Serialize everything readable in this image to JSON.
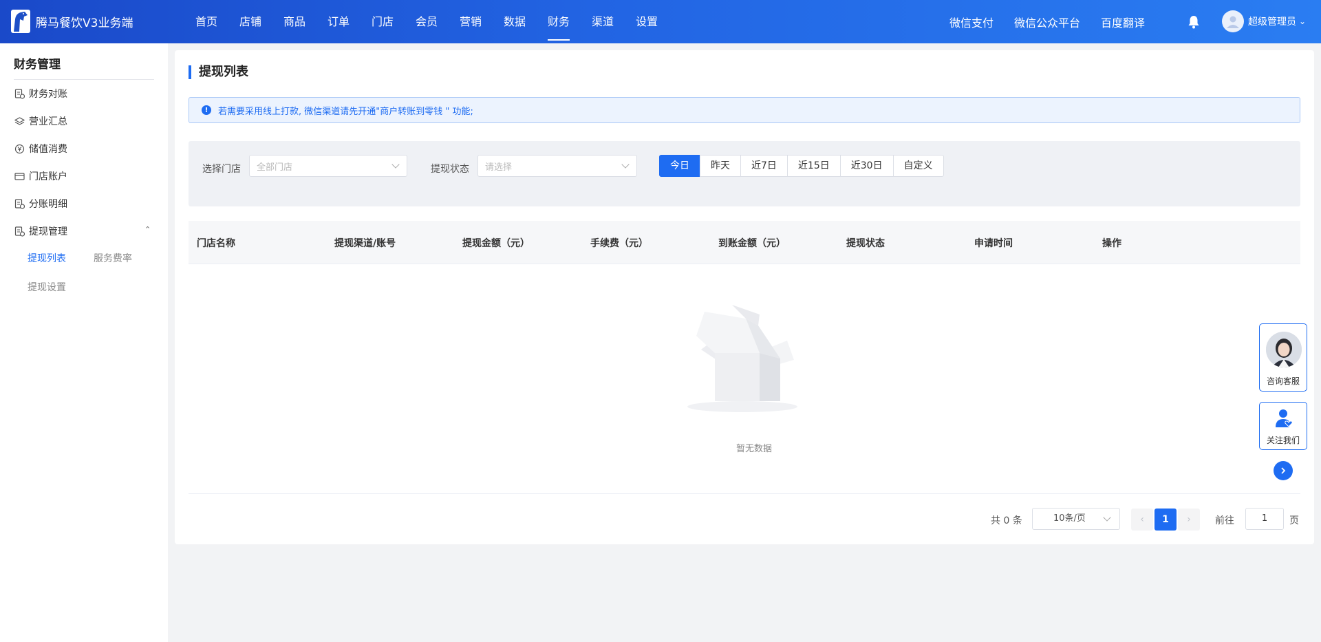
{
  "app": {
    "title": "腾马餐饮V3业务端"
  },
  "nav": {
    "items": [
      {
        "label": "首页"
      },
      {
        "label": "店铺"
      },
      {
        "label": "商品"
      },
      {
        "label": "订单"
      },
      {
        "label": "门店"
      },
      {
        "label": "会员"
      },
      {
        "label": "营销"
      },
      {
        "label": "数据"
      },
      {
        "label": "财务",
        "active": true
      },
      {
        "label": "渠道"
      },
      {
        "label": "设置"
      }
    ],
    "right_links": [
      "微信支付",
      "微信公众平台",
      "百度翻译"
    ],
    "user_name": "超级管理员"
  },
  "sidebar": {
    "title": "财务管理",
    "items": [
      {
        "label": "财务对账",
        "icon": "ledger-icon"
      },
      {
        "label": "营业汇总",
        "icon": "layers-icon"
      },
      {
        "label": "储值消费",
        "icon": "yen-circle-icon"
      },
      {
        "label": "门店账户",
        "icon": "card-icon"
      },
      {
        "label": "分账明细",
        "icon": "ledger-icon"
      },
      {
        "label": "提现管理",
        "icon": "ledger-icon",
        "expanded": true
      }
    ],
    "sub_items": [
      {
        "label": "提现列表",
        "active": true
      },
      {
        "label": "服务费率"
      },
      {
        "label": "提现设置"
      }
    ]
  },
  "main": {
    "page_title": "提现列表",
    "alert": "若需要采用线上打款, 微信渠道请先开通\"商户转账到零钱 \" 功能;",
    "filter": {
      "store_label": "选择门店",
      "store_placeholder": "全部门店",
      "status_label": "提现状态",
      "status_placeholder": "请选择",
      "date_buttons": [
        "今日",
        "昨天",
        "近7日",
        "近15日",
        "近30日",
        "自定义"
      ],
      "date_active": "今日"
    },
    "table": {
      "columns": [
        "门店名称",
        "提现渠道/账号",
        "提现金额（元）",
        "手续费（元）",
        "到账金额（元）",
        "提现状态",
        "申请时间",
        "操作"
      ],
      "rows": [],
      "empty_text": "暂无数据"
    },
    "pagination": {
      "total": "共 0 条",
      "page_size": "10条/页",
      "current_page": "1",
      "goto_label": "前往",
      "goto_value": "1",
      "page_unit": "页"
    }
  },
  "floating": {
    "consult": "咨询客服",
    "follow": "关注我们"
  },
  "colors": {
    "primary": "#1e6cf2",
    "topbar_start": "#1a49c9",
    "topbar_end": "#2a7df2"
  }
}
